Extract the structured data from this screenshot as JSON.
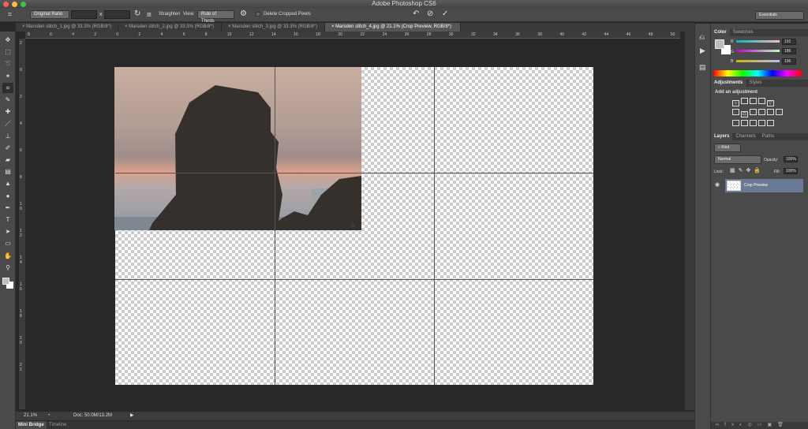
{
  "app": {
    "title": "Adobe Photoshop CS6"
  },
  "options": {
    "ratio": "Original Ratio",
    "x_sep": "x",
    "straighten": "Straighten",
    "view_label": "View:",
    "view_value": "Rule of Thirds",
    "delete_cropped": "Delete Cropped Pixels",
    "workspace": "Essentials"
  },
  "tabs": [
    {
      "label": "Marsden stitch_1.jpg @ 33.3% (RGB/8*)"
    },
    {
      "label": "Marsden stitch_2.jpg @ 33.3% (RGB/8*)"
    },
    {
      "label": "Marsden stitch_3.jpg @ 33.3% (RGB/8*)"
    },
    {
      "label": "Marsden stitch_4.jpg @ 21.1% (Crop Preview, RGB/8*)"
    }
  ],
  "ruler_h": [
    "8",
    "6",
    "4",
    "2",
    "0",
    "2",
    "4",
    "6",
    "8",
    "10",
    "12",
    "14",
    "16",
    "18",
    "20",
    "22",
    "24",
    "26",
    "28",
    "30",
    "32",
    "34",
    "36",
    "38",
    "40",
    "42",
    "44",
    "46",
    "48",
    "50"
  ],
  "ruler_v": [
    "2",
    "0",
    "2",
    "4",
    "6",
    "8",
    "10",
    "12",
    "14",
    "16",
    "18",
    "20",
    "22"
  ],
  "status": {
    "zoom": "21.1%",
    "doc": "Doc: 50.0M/13.2M"
  },
  "bottom_tabs": [
    "Mini Bridge",
    "Timeline"
  ],
  "color_panel": {
    "tabs": [
      "Color",
      "Swatches"
    ],
    "channels": [
      {
        "label": "R",
        "value": "192"
      },
      {
        "label": "G",
        "value": "186"
      },
      {
        "label": "B",
        "value": "196"
      }
    ],
    "foreground": "#c0bac4"
  },
  "adjustments_panel": {
    "tabs": [
      "Adjustments",
      "Styles"
    ],
    "heading": "Add an adjustment"
  },
  "layers_panel": {
    "tabs": [
      "Layers",
      "Channels",
      "Paths"
    ],
    "filter": "Kind",
    "blend": "Normal",
    "opacity_label": "Opacity:",
    "opacity": "100%",
    "lock_label": "Lock:",
    "fill_label": "Fill:",
    "fill": "100%",
    "layers": [
      {
        "name": "Crop Preview"
      }
    ]
  }
}
